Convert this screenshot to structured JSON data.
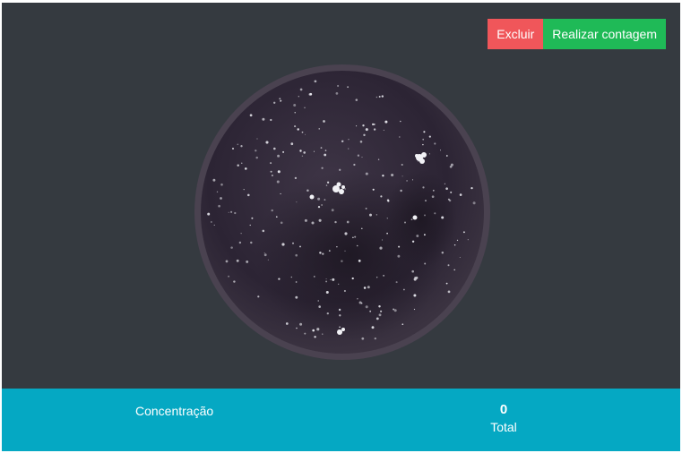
{
  "toolbar": {
    "delete_label": "Excluir",
    "count_label": "Realizar contagem"
  },
  "colors": {
    "canvas_bg": "#353a40",
    "delete_button": "#f0565a",
    "count_button": "#1fba57",
    "footer_bg": "#05a8c3",
    "dish_fill": "#3a3140"
  },
  "image": {
    "subject": "petri-dish-with-colonies"
  },
  "footer": {
    "concentration_label": "Concentração",
    "total_value": "0",
    "total_label": "Total"
  }
}
